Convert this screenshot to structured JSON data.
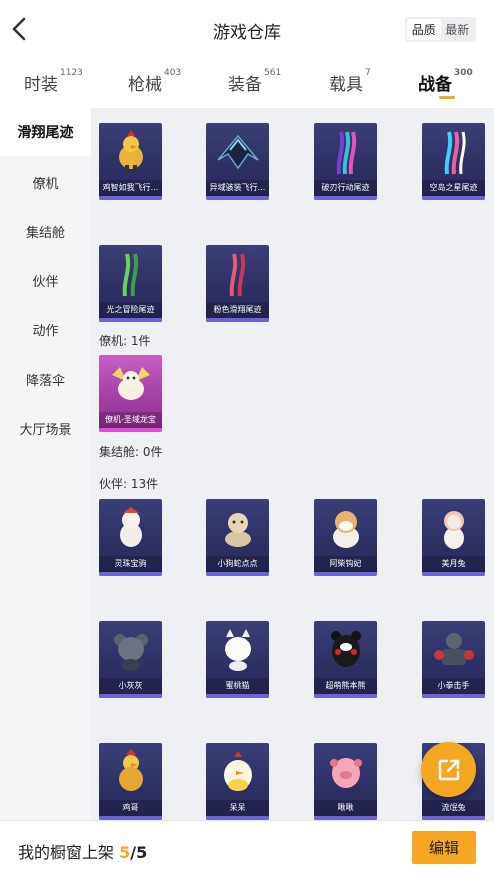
{
  "header": {
    "title": "游戏仓库",
    "sort_options": [
      "品质",
      "最新"
    ]
  },
  "tabs": [
    {
      "label": "时装",
      "count": "1123"
    },
    {
      "label": "枪械",
      "count": "403"
    },
    {
      "label": "装备",
      "count": "561"
    },
    {
      "label": "载具",
      "count": "7"
    },
    {
      "label": "战备",
      "count": "300"
    }
  ],
  "sidebar": {
    "items": [
      "滑翔尾迹",
      "僚机",
      "集结舱",
      "伙伴",
      "动作",
      "降落伞",
      "大厅场景"
    ]
  },
  "sections": {
    "trails": {
      "items": [
        "鸡智如我飞行...",
        "异域骇装飞行...",
        "破刃行动尾迹",
        "空岛之星尾迹",
        "光之冒险尾迹",
        "粉色滑翔尾迹"
      ]
    },
    "wingman": {
      "label": "僚机: 1件",
      "items": [
        "僚机-圣域龙宝"
      ]
    },
    "pod": {
      "label": "集结舱: 0件"
    },
    "companions": {
      "label": "伙伴: 13件",
      "items": [
        "灵珠宝驹",
        "小狗蛇点点",
        "阿柴钩妃",
        "美月兔",
        "小灰灰",
        "蜜桃猫",
        "超萌熊本熊",
        "小拳击手",
        "鸡哥",
        "呆呆",
        "啾啾",
        "流氓兔"
      ]
    }
  },
  "bottom": {
    "showcase_label": "我的橱窗上架",
    "showcase_count": "5",
    "showcase_total": "/5",
    "edit_label": "编辑"
  },
  "colors": {
    "accent": "#f5a623",
    "card_bg": "#2d2f63",
    "card_epic_bg": "#a43fa6"
  },
  "icons": {
    "back": "chevron-left-icon",
    "share": "share-external-icon"
  }
}
